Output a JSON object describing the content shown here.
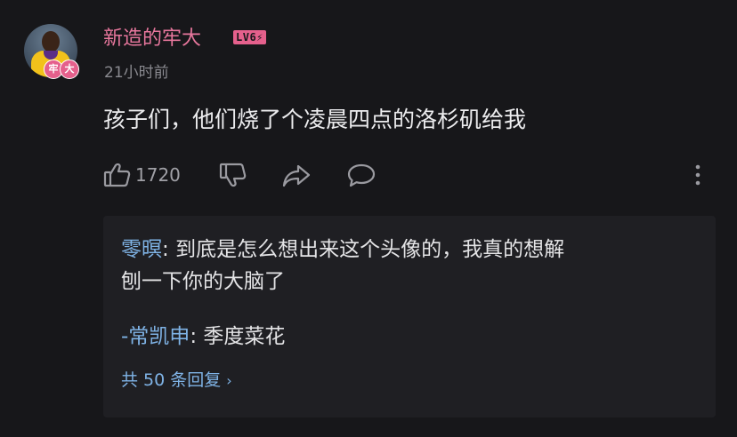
{
  "comment": {
    "author": "新造的牢大",
    "level": "LV6⚡",
    "avatar_badges": [
      "牢",
      "大"
    ],
    "timestamp": "21小时前",
    "text": "孩子们，他们烧了个凌晨四点的洛杉矶给我",
    "like_count": "1720",
    "icons": {
      "like": "thumbs-up-icon",
      "dislike": "thumbs-down-icon",
      "share": "share-icon",
      "reply": "comment-icon",
      "more": "more-vertical-icon"
    }
  },
  "replies": {
    "items": [
      {
        "author": "零暝",
        "separator": ": ",
        "text_line1": "到底是怎么想出来这个头像的，我真的想解",
        "text_line2": "刨一下你的大脑了"
      },
      {
        "author": "-常凯申",
        "separator": ": ",
        "text": "季度菜花"
      }
    ],
    "more_label": "共 50 条回复",
    "more_chevron": "›"
  },
  "colors": {
    "background": "#17171a",
    "reply_panel": "#1f1f23",
    "username": "#e8779d",
    "link_blue": "#7fb3e6",
    "muted": "#8a8a90"
  }
}
